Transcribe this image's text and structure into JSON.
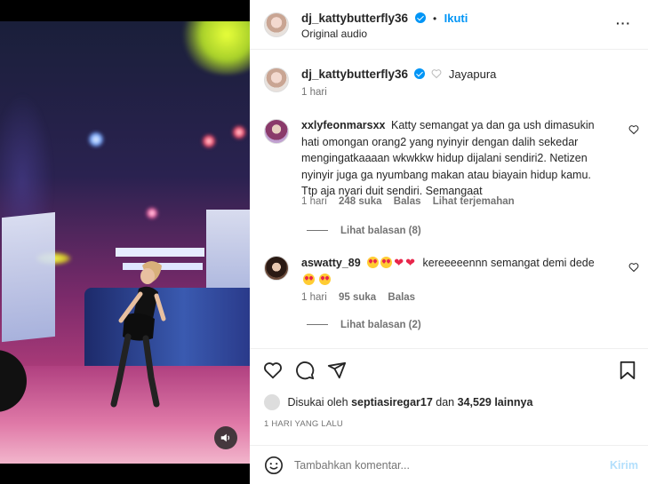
{
  "post": {
    "username": "dj_kattybutterfly36",
    "separator": "•",
    "follow_label": "Ikuti",
    "audio": "Original audio",
    "more_label": "···"
  },
  "caption": {
    "username": "dj_kattybutterfly36",
    "location": "Jayapura",
    "time": "1 hari"
  },
  "comments": [
    {
      "username": "xxlyfeonmarsxx",
      "text": "Katty semangat ya dan ga ush dimasukin hati omongan orang2 yang nyinyir dengan dalih sekedar mengingatkaaaan wkwkkw hidup dijalani sendiri2. Netizen nyinyir juga ga nyumbang makan atau biayain hidup kamu. Ttp aja nyari duit sendiri. Semangaat",
      "time": "1 hari",
      "likes": "248 suka",
      "reply": "Balas",
      "translate": "Lihat terjemahan",
      "view_replies": "Lihat balasan (8)"
    },
    {
      "username": "aswatty_89",
      "text": "kereeeeennn semangat demi dede",
      "time": "1 hari",
      "likes": "95 suka",
      "reply": "Balas",
      "view_replies": "Lihat balasan (2)"
    }
  ],
  "likes": {
    "prefix": "Disukai oleh",
    "user": "septiasiregar17",
    "middle": "dan",
    "others": "34,529 lainnya"
  },
  "timestamp": "1 HARI YANG LALU",
  "comment_input": {
    "placeholder": "Tambahkan komentar...",
    "send_label": "Kirim"
  },
  "colors": {
    "accent": "#0095f6",
    "heart": "#e8264b",
    "meta": "#737373"
  }
}
